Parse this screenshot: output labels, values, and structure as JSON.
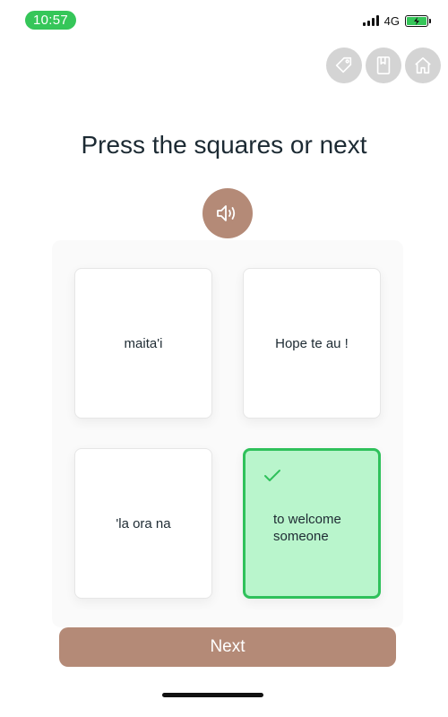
{
  "status_bar": {
    "time": "10:57",
    "network": "4G",
    "time_color": "#35c659",
    "battery_color": "#35c659"
  },
  "top_icons": [
    "tag-icon",
    "book-icon",
    "home-icon"
  ],
  "title": "Press the squares or next",
  "audio_button": {
    "icon": "speaker-icon",
    "color": "#b48a77"
  },
  "cards": [
    {
      "text": "maita'i",
      "selected": false
    },
    {
      "text": "Hope te au !",
      "selected": false
    },
    {
      "text": "'la ora na",
      "selected": false
    },
    {
      "text": "to welcome someone",
      "selected": true,
      "selected_color": "#b9f5cc",
      "selected_border": "#2fc15b"
    }
  ],
  "next_button": {
    "label": "Next",
    "color": "#b48a77"
  }
}
